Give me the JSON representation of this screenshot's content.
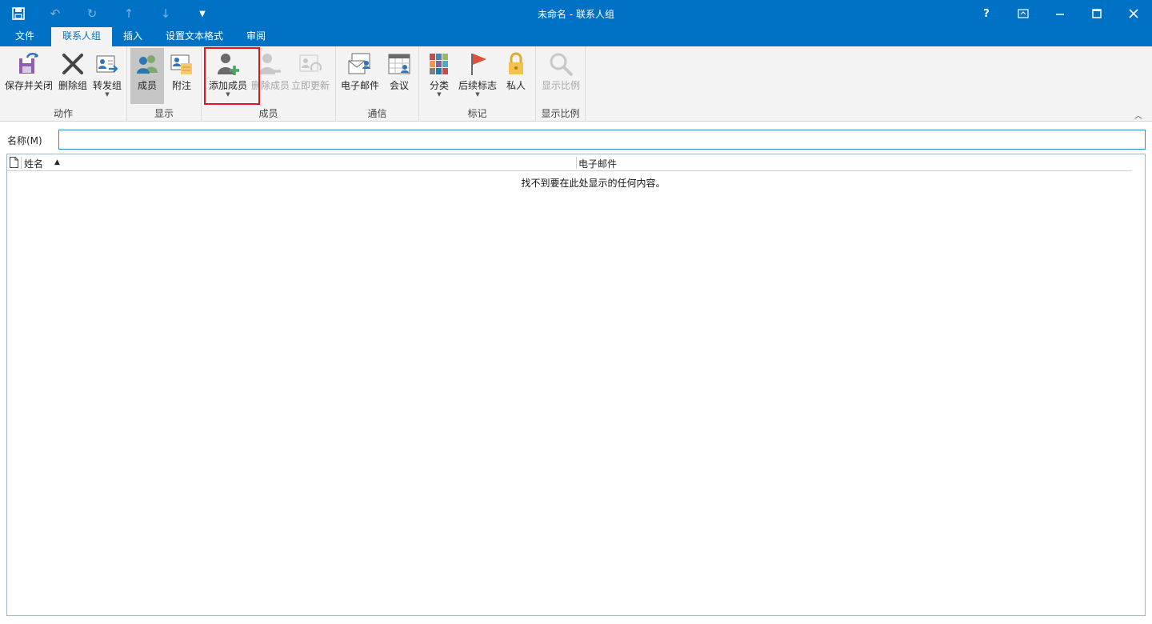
{
  "window": {
    "title": "未命名 - 联系人组"
  },
  "qat": {
    "save_icon": "save-icon",
    "undo_icon": "undo-icon",
    "redo_icon": "redo-icon",
    "up_icon": "up-arrow-icon",
    "down_icon": "down-arrow-icon",
    "customize_icon": "customize-icon"
  },
  "window_controls": {
    "help": "?",
    "ribbon_display": "ribbon-display-icon",
    "minimize": "minimize-icon",
    "maximize": "maximize-icon",
    "close": "close-icon"
  },
  "tabs": [
    "文件",
    "联系人组",
    "插入",
    "设置文本格式",
    "审阅"
  ],
  "active_tab": "联系人组",
  "ribbon": {
    "groups": {
      "actions": {
        "label": "动作",
        "save_close": "保存并关闭",
        "delete_group": "删除组",
        "forward_group": "转发组"
      },
      "show": {
        "label": "显示",
        "members": "成员",
        "notes": "附注"
      },
      "members": {
        "label": "成员",
        "add_members": "添加成员",
        "remove_member": "删除成员",
        "update_now": "立即更新"
      },
      "communicate": {
        "label": "通信",
        "email": "电子邮件",
        "meeting": "会议"
      },
      "tags": {
        "label": "标记",
        "categorize": "分类",
        "follow_up": "后续标志",
        "private": "私人"
      },
      "zoom": {
        "label": "显示比例",
        "zoom": "显示比例"
      }
    }
  },
  "name_field": {
    "label": "名称(M)",
    "value": ""
  },
  "list": {
    "columns": [
      "姓名",
      "电子邮件"
    ],
    "sort_column": "姓名",
    "sort_direction": "ascending",
    "empty_message": "找不到要在此处显示的任何内容。"
  },
  "colors": {
    "accent": "#0072c6",
    "ribbon_bg": "#f3f3f3",
    "highlight": "#e81123"
  }
}
